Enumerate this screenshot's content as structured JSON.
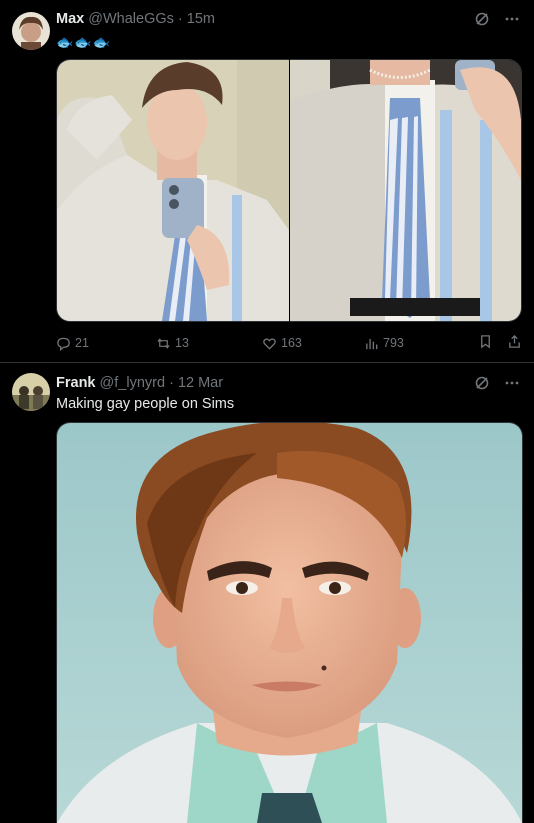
{
  "tweets": [
    {
      "author_name": "Max",
      "handle": "@WhaleGGs",
      "separator": "·",
      "time": "15m",
      "text": "🐟🐟🐟",
      "text_color": "#1d9bf0",
      "actions": {
        "replies": "21",
        "reposts": "13",
        "likes": "163",
        "views": "793"
      }
    },
    {
      "author_name": "Frank",
      "handle": "@f_lynyrd",
      "separator": "·",
      "time": "12 Mar",
      "text": "Making gay people on Sims"
    }
  ],
  "icons": {
    "grok": "grok-icon",
    "more": "more-icon",
    "reply": "reply-icon",
    "repost": "repost-icon",
    "like": "heart-icon",
    "views": "views-icon",
    "bookmark": "bookmark-icon",
    "share": "share-icon"
  },
  "colors": {
    "background": "#000000",
    "text": "#e7e9ea",
    "muted": "#71767b",
    "accent": "#1d9bf0",
    "divider": "#2f3336"
  }
}
